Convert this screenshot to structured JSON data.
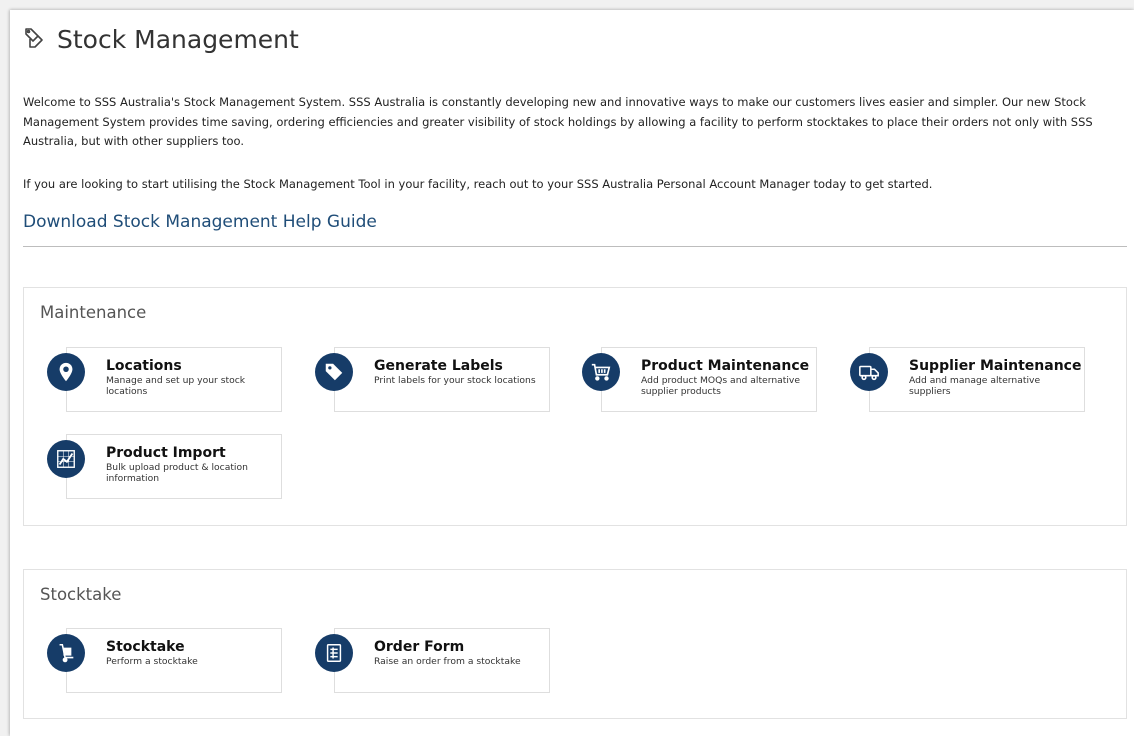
{
  "page": {
    "title": "Stock Management",
    "title_icon": "tags-outline-icon"
  },
  "intro": {
    "paragraph1": "Welcome to SSS Australia's Stock Management System. SSS Australia is constantly developing new and innovative ways to make our customers lives easier and simpler. Our new Stock Management System provides time saving, ordering efficiencies and greater visibility of stock holdings by allowing a facility to perform stocktakes to place their orders not only with SSS Australia, but with other suppliers too.",
    "paragraph2": "If you are looking to start utilising the Stock Management Tool in your facility, reach out to your SSS Australia Personal Account Manager today to get started.",
    "help_link": "Download Stock Management Help Guide"
  },
  "maintenance": {
    "title": "Maintenance",
    "cards": [
      {
        "title": "Locations",
        "desc": "Manage and set up your stock locations",
        "icon": "map-pin-icon"
      },
      {
        "title": "Generate Labels",
        "desc": "Print labels for your stock locations",
        "icon": "tag-icon"
      },
      {
        "title": "Product Maintenance",
        "desc": "Add product MOQs and alternative supplier products",
        "icon": "shopping-cart-icon"
      },
      {
        "title": "Supplier Maintenance",
        "desc": "Add and manage alternative suppliers",
        "icon": "truck-icon"
      },
      {
        "title": "Product Import",
        "desc": "Bulk upload product & location information",
        "icon": "chart-import-icon"
      }
    ]
  },
  "stocktake": {
    "title": "Stocktake",
    "cards": [
      {
        "title": "Stocktake",
        "desc": "Perform a stocktake",
        "icon": "hand-truck-icon"
      },
      {
        "title": "Order Form",
        "desc": "Raise an order from a stocktake",
        "icon": "order-form-icon"
      }
    ]
  },
  "colors": {
    "icon_circle": "#163c68",
    "link": "#1f4d78"
  }
}
